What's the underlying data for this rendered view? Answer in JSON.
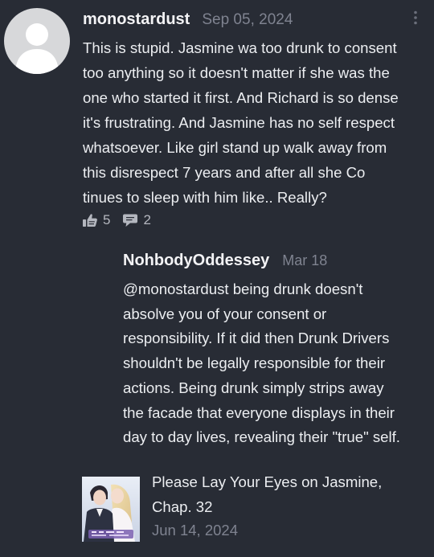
{
  "comment": {
    "username": "monostardust",
    "date": "Sep 05, 2024",
    "text_lines": [
      "This is stupid. Jasmine wa too drunk to consent",
      "too anything so it doesn't matter if she was the",
      "one who started it first. And Richard is so dense",
      "it's frustrating. And Jasmine has no self respect",
      "whatsoever. Like girl stand up walk away from",
      "this disrespect 7 years and after all she Co",
      "tinues to sleep with him like.. Really?"
    ],
    "like_count": "5",
    "reply_count": "2"
  },
  "reply": {
    "username": "NohbodyOddessey",
    "date": "Mar 18",
    "text_lines": [
      "@monostardust being drunk doesn't",
      "absolve you of your consent or",
      "responsibility. If it did then Drunk Drivers",
      "shouldn't be legally responsible for their",
      "actions. Being drunk simply strips away",
      "the facade that everyone displays in their",
      "day to day lives, revealing their \"true\" self."
    ]
  },
  "source": {
    "title_lines": [
      "Please Lay Your Eyes on Jasmine,",
      "Chap. 32"
    ],
    "date": "Jun 14, 2024"
  },
  "colors": {
    "background": "#282c35",
    "text": "#eceef1",
    "muted": "#7f8390",
    "avatar": "#d7d8da"
  },
  "icons": {
    "like": "thumbs-up-icon",
    "reply": "speech-bubble-icon",
    "menu": "kebab-menu-icon",
    "avatar": "default-user-icon"
  }
}
